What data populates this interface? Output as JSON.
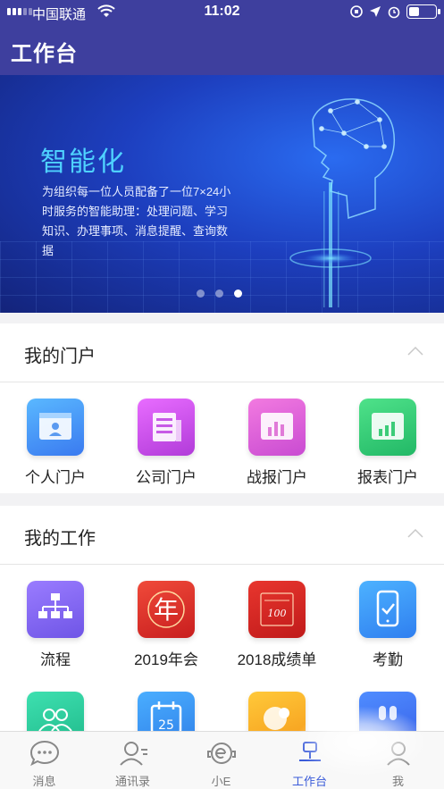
{
  "status_bar": {
    "carrier": "中国联通",
    "time": "11:02"
  },
  "header": {
    "title": "工作台"
  },
  "banner": {
    "title": "智能化",
    "description": "为组织每一位人员配备了一位7×24小时服务的智能助理：处理问题、学习知识、办理事项、消息提醒、查询数据",
    "page_count": 3,
    "active_page": 3
  },
  "portal": {
    "title": "我的门户",
    "items": [
      {
        "label": "个人门户",
        "icon": "personal-portal-icon"
      },
      {
        "label": "公司门户",
        "icon": "company-portal-icon"
      },
      {
        "label": "战报门户",
        "icon": "battle-report-portal-icon"
      },
      {
        "label": "报表门户",
        "icon": "report-portal-icon"
      }
    ]
  },
  "work": {
    "title": "我的工作",
    "items": [
      {
        "label": "流程",
        "icon": "flowchart-icon"
      },
      {
        "label": "2019年会",
        "icon": "annual-meeting-icon",
        "icon_text": "年"
      },
      {
        "label": "2018成绩单",
        "icon": "report-card-icon",
        "icon_text": "100"
      },
      {
        "label": "考勤",
        "icon": "attendance-phone-icon"
      }
    ],
    "partial_items": [
      {
        "icon": "group-icon"
      },
      {
        "icon": "calendar-icon",
        "icon_text": "25"
      },
      {
        "icon": "orange-app-icon"
      },
      {
        "icon": "blue-app-icon"
      }
    ]
  },
  "tabbar": {
    "items": [
      {
        "label": "消息",
        "icon": "chat-bubble-icon"
      },
      {
        "label": "通讯录",
        "icon": "contacts-icon"
      },
      {
        "label": "小E",
        "icon": "assistant-icon"
      },
      {
        "label": "工作台",
        "icon": "workbench-icon",
        "active": true
      },
      {
        "label": "我",
        "icon": "profile-icon"
      }
    ]
  },
  "colors": {
    "header": "#3e3f9e",
    "active_tab": "#3a5bd9",
    "banner_title": "#4fd2ff"
  }
}
